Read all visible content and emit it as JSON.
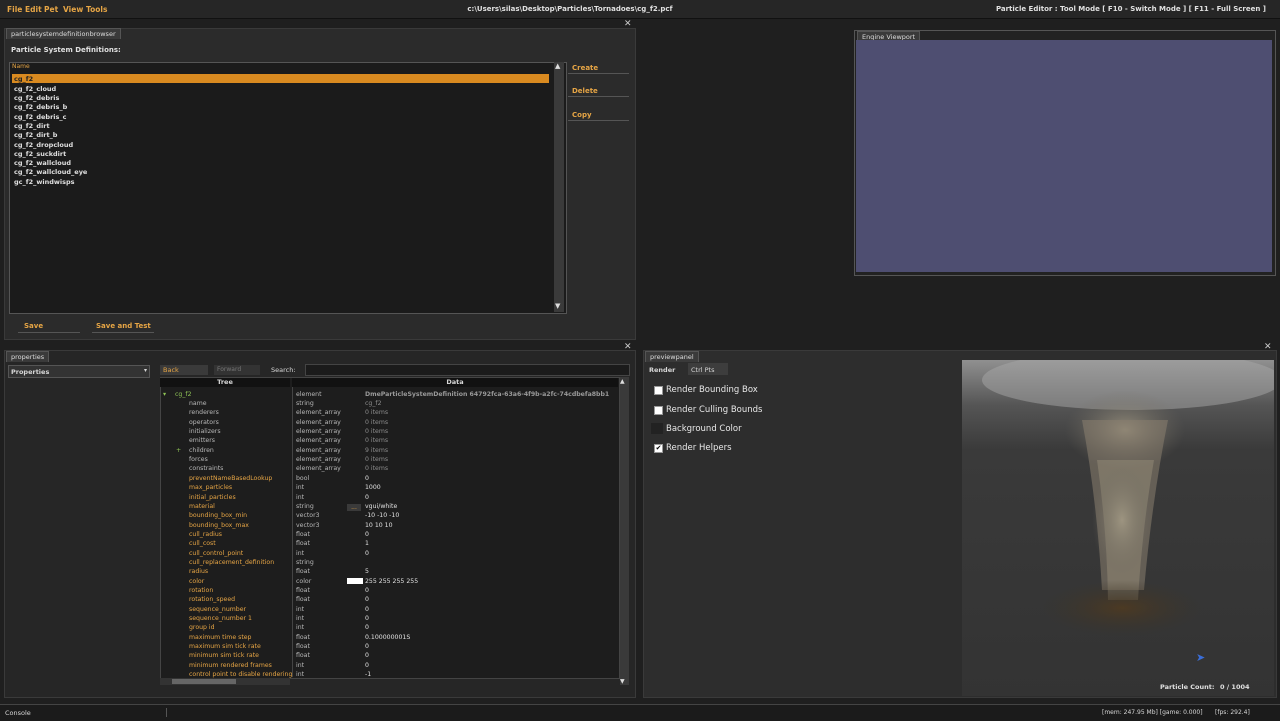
{
  "menubar": {
    "items": [
      "File",
      "Edit",
      "Pet",
      "View",
      "Tools"
    ],
    "path": "c:\\Users\\silas\\Desktop\\Particles\\Tornadoes\\cg_f2.pcf",
    "mode": "Particle Editor : Tool Mode [ F10 - Switch Mode ] [ F11 - Full Screen ]"
  },
  "browser": {
    "tab": "particlesystemdefinitionbrowser",
    "heading": "Particle System Definitions:",
    "col": "Name",
    "items": [
      "cg_f2",
      "cg_f2_cloud",
      "cg_f2_debris",
      "cg_f2_debris_b",
      "cg_f2_debris_c",
      "cg_f2_dirt",
      "cg_f2_dirt_b",
      "cg_f2_dropcloud",
      "cg_f2_suckdirt",
      "cg_f2_wallcloud",
      "cg_f2_wallcloud_eye",
      "gc_f2_windwisps"
    ],
    "create": "Create",
    "delete": "Delete",
    "copy": "Copy",
    "save": "Save",
    "save_test": "Save and Test"
  },
  "viewport": {
    "title": "Engine Viewport",
    "bg": "#4e4e71"
  },
  "properties": {
    "tab": "properties",
    "dropdown": "Properties",
    "back": "Back",
    "forward": "Forward",
    "search": "Search:",
    "col_tree": "Tree",
    "col_data": "Data",
    "root": "cg_f2",
    "root_type": "element",
    "root_data": "DmeParticleSystemDefinition 64792fca-63a6-4f9b-a2fc-74cdbefa8bb1",
    "rows": [
      {
        "n": "name",
        "t": "string",
        "d": "cg_f2",
        "c": "gr"
      },
      {
        "n": "renderers",
        "t": "element_array",
        "d": "0 items",
        "c": "gr"
      },
      {
        "n": "operators",
        "t": "element_array",
        "d": "0 items",
        "c": "gr"
      },
      {
        "n": "initializers",
        "t": "element_array",
        "d": "0 items",
        "c": "gr"
      },
      {
        "n": "emitters",
        "t": "element_array",
        "d": "0 items",
        "c": "gr"
      },
      {
        "n": "children",
        "t": "element_array",
        "d": "9 items",
        "c": "gr"
      },
      {
        "n": "forces",
        "t": "element_array",
        "d": "0 items",
        "c": "gr"
      },
      {
        "n": "constraints",
        "t": "element_array",
        "d": "0 items",
        "c": "gr"
      },
      {
        "n": "preventNameBasedLookup",
        "t": "bool",
        "d": "0",
        "c": "y"
      },
      {
        "n": "max_particles",
        "t": "int",
        "d": "1000",
        "c": "y"
      },
      {
        "n": "initial_particles",
        "t": "int",
        "d": "0",
        "c": "y"
      },
      {
        "n": "material",
        "t": "string",
        "d": "vgui/white",
        "c": "y"
      },
      {
        "n": "bounding_box_min",
        "t": "vector3",
        "d": "-10 -10 -10",
        "c": "y"
      },
      {
        "n": "bounding_box_max",
        "t": "vector3",
        "d": "10 10 10",
        "c": "y"
      },
      {
        "n": "cull_radius",
        "t": "float",
        "d": "0",
        "c": "y"
      },
      {
        "n": "cull_cost",
        "t": "float",
        "d": "1",
        "c": "y"
      },
      {
        "n": "cull_control_point",
        "t": "int",
        "d": "0",
        "c": "y"
      },
      {
        "n": "cull_replacement_definition",
        "t": "string",
        "d": "",
        "c": "y"
      },
      {
        "n": "radius",
        "t": "float",
        "d": "5",
        "c": "y"
      },
      {
        "n": "color",
        "t": "color",
        "d": "255 255 255 255",
        "c": "y"
      },
      {
        "n": "rotation",
        "t": "float",
        "d": "0",
        "c": "y"
      },
      {
        "n": "rotation_speed",
        "t": "float",
        "d": "0",
        "c": "y"
      },
      {
        "n": "sequence_number",
        "t": "int",
        "d": "0",
        "c": "y"
      },
      {
        "n": "sequence_number 1",
        "t": "int",
        "d": "0",
        "c": "y"
      },
      {
        "n": "group id",
        "t": "int",
        "d": "0",
        "c": "y"
      },
      {
        "n": "maximum time step",
        "t": "float",
        "d": "0.100000001S",
        "c": "y"
      },
      {
        "n": "maximum sim tick rate",
        "t": "float",
        "d": "0",
        "c": "y"
      },
      {
        "n": "minimum sim tick rate",
        "t": "float",
        "d": "0",
        "c": "y"
      },
      {
        "n": "minimum rendered frames",
        "t": "int",
        "d": "0",
        "c": "y"
      },
      {
        "n": "control point to disable rendering",
        "t": "int",
        "d": "-1",
        "c": "y"
      }
    ],
    "children_expander": "+",
    "material_btn": "..."
  },
  "preview": {
    "tab": "previewpanel",
    "tab_render": "Render",
    "tab_ctrl": "Ctrl Pts",
    "opts": [
      {
        "label": "Render Bounding Box",
        "checked": false
      },
      {
        "label": "Render Culling Bounds",
        "checked": false
      },
      {
        "label": "Background Color",
        "checked": null
      },
      {
        "label": "Render Helpers",
        "checked": true
      }
    ],
    "count_label": "Particle Count:",
    "count_value": "0 / 1004"
  },
  "status": {
    "console": "Console",
    "mem": "[mem: 247.95 Mb] [game: 0.000]",
    "fps": "[fps: 292.4]"
  }
}
